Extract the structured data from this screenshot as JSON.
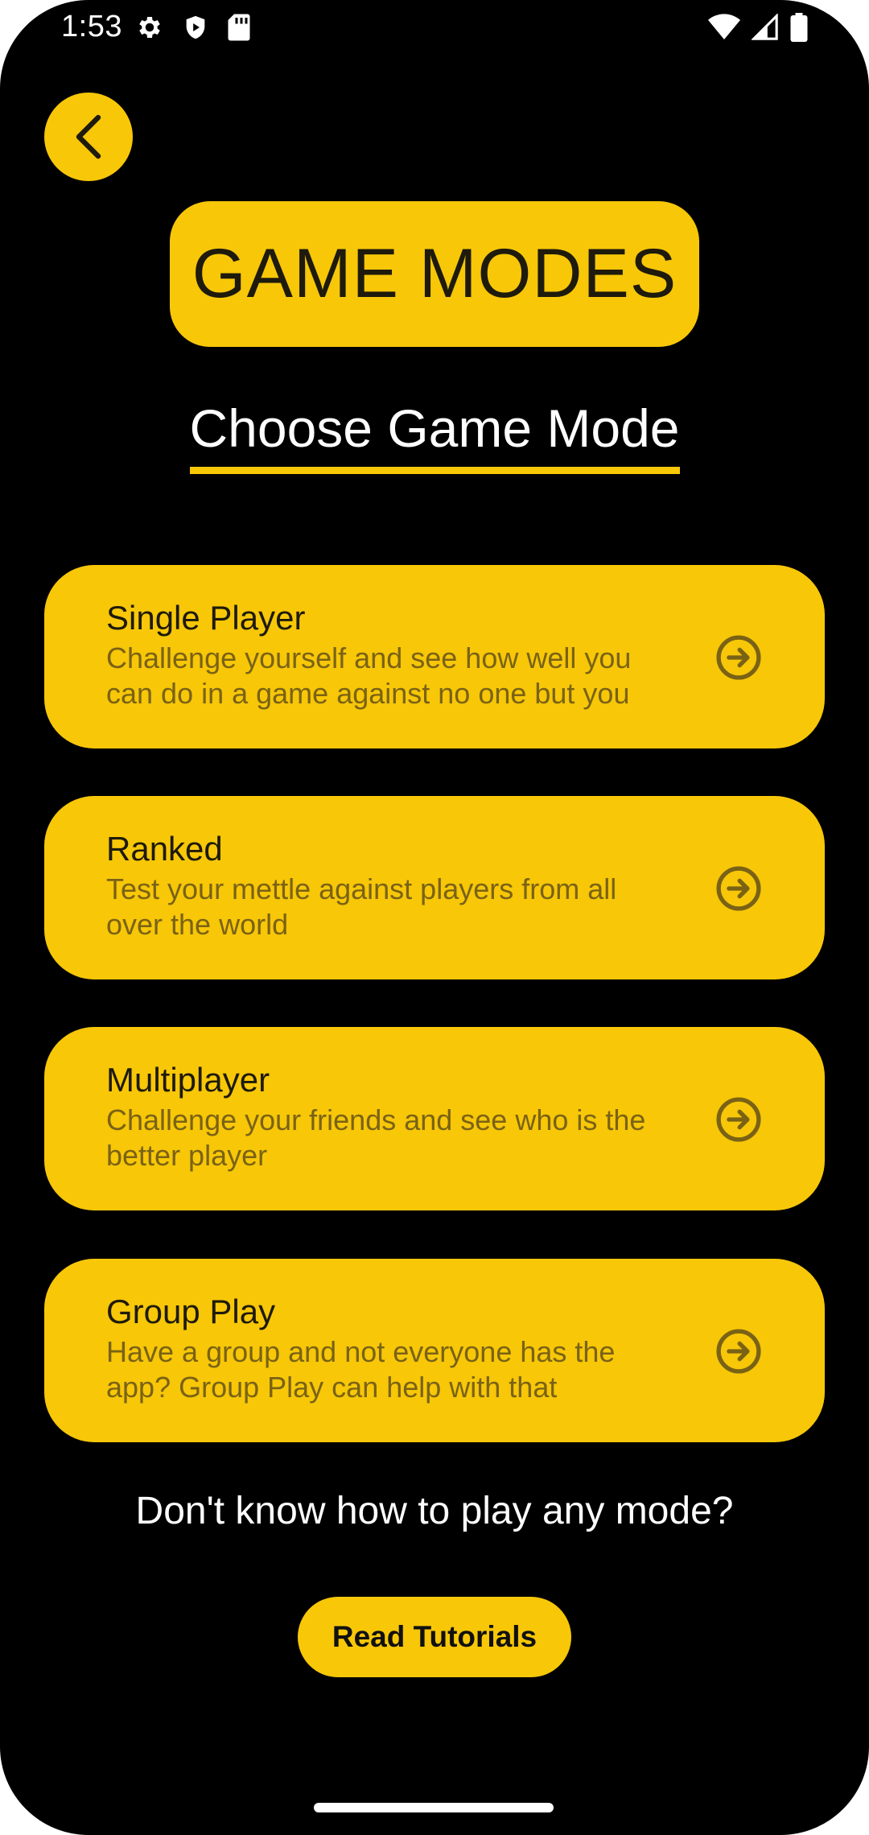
{
  "status_bar": {
    "time": "1:53",
    "left_icons": [
      "gear-icon",
      "shield-icon",
      "sd-card-icon"
    ],
    "right_icons": [
      "wifi-icon",
      "cell-signal-icon",
      "battery-icon"
    ]
  },
  "header": {
    "back_icon": "chevron-left-icon",
    "title": "GAME MODES",
    "subtitle": "Choose Game Mode"
  },
  "modes": [
    {
      "name": "Single Player",
      "description": "Challenge yourself and see how well you can do in a game against no one but you",
      "icon": "arrow-right-circle-icon"
    },
    {
      "name": "Ranked",
      "description": "Test your mettle against players from all over the world",
      "icon": "arrow-right-circle-icon"
    },
    {
      "name": "Multiplayer",
      "description": "Challenge your friends and see who is the better player",
      "icon": "arrow-right-circle-icon"
    },
    {
      "name": "Group Play",
      "description": "Have a group and not everyone has the app? Group Play can help with that",
      "icon": "arrow-right-circle-icon"
    }
  ],
  "footer": {
    "help_text": "Don't know how to play any mode?",
    "tutorial_label": "Read Tutorials"
  },
  "colors": {
    "background": "#000000",
    "accent": "#f7c708",
    "card_title": "#1e1a0c",
    "card_desc": "#7a6215",
    "text": "#ffffff"
  }
}
